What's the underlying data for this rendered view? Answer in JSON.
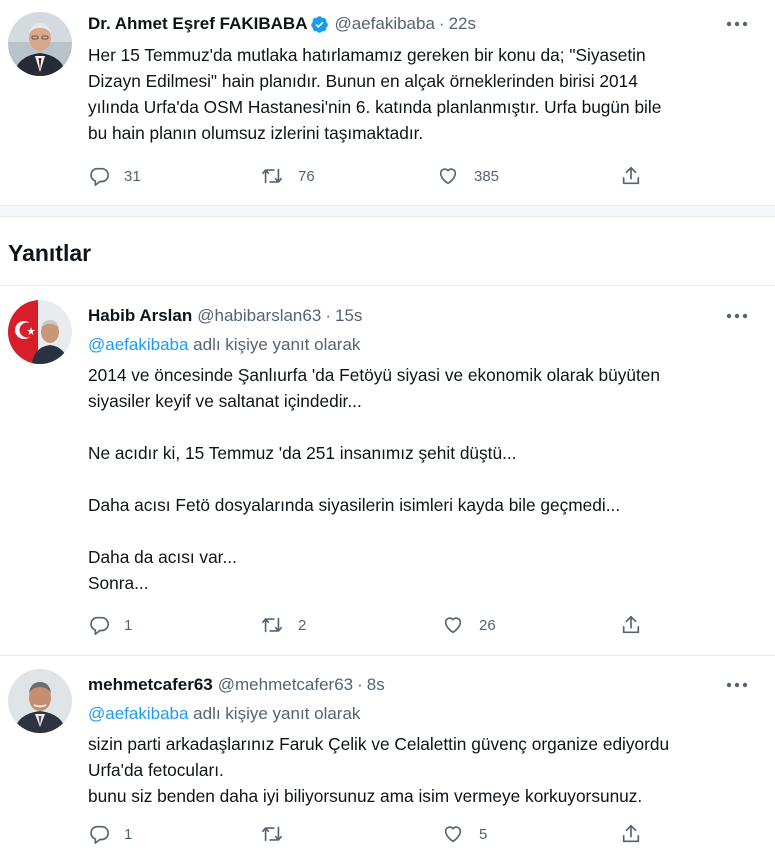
{
  "main_tweet": {
    "name": "Dr. Ahmet Eşref FAKIBABA",
    "handle": "@aefakibaba",
    "time": "22s",
    "lines": [
      "Her 15 Temmuz'da mutlaka hatırlamamız gereken bir konu da;  \"Siyasetin",
      "Dizayn Edilmesi\" hain planıdır. Bunun en alçak örneklerinden birisi 2014",
      "yılında Urfa'da OSM Hastanesi'nin 6. katında planlanmıştır. Urfa bugün bile",
      "bu hain planın olumsuz izlerini taşımaktadır."
    ],
    "replies": "31",
    "retweets": "76",
    "likes": "385"
  },
  "section_title": "Yanıtlar",
  "replies": [
    {
      "name": "Habib Arslan",
      "handle": "@habibarslan63",
      "time": "15s",
      "replying_mention": "@aefakibaba",
      "replying_suffix": " adlı kişiye yanıt olarak",
      "lines": [
        "2014 ve öncesinde Şanlıurfa 'da Fetöyü siyasi ve ekonomik olarak büyüten",
        "siyasiler keyif ve saltanat içindedir...",
        "",
        "Ne acıdır ki, 15 Temmuz 'da 251 insanımız şehit düştü...",
        "",
        "Daha acısı Fetö dosyalarında siyasilerin isimleri kayda bile geçmedi...",
        "",
        "Daha da acısı var...",
        "Sonra..."
      ],
      "replies": "1",
      "retweets": "2",
      "likes": "26"
    },
    {
      "name": "mehmetcafer63",
      "handle": "@mehmetcafer63",
      "time": "8s",
      "replying_mention": "@aefakibaba",
      "replying_suffix": " adlı kişiye yanıt olarak",
      "lines": [
        "sizin parti arkadaşlarınız Faruk Çelik ve Celalettin güvenç organize ediyordu",
        "Urfa'da fetocuları.",
        "bunu siz benden daha iyi biliyorsunuz ama isim vermeye korkuyorsunuz."
      ],
      "replies": "1",
      "retweets": "",
      "likes": "5"
    }
  ],
  "colors": {
    "text": "#0f1419",
    "muted": "#536471",
    "accent": "#1d9bf0",
    "divider": "#e6ecf0"
  },
  "icons": {
    "verified": "verified-badge-icon",
    "more": "more-horizontal-icon",
    "reply": "reply-icon",
    "retweet": "retweet-icon",
    "like": "heart-icon",
    "share": "share-icon"
  }
}
